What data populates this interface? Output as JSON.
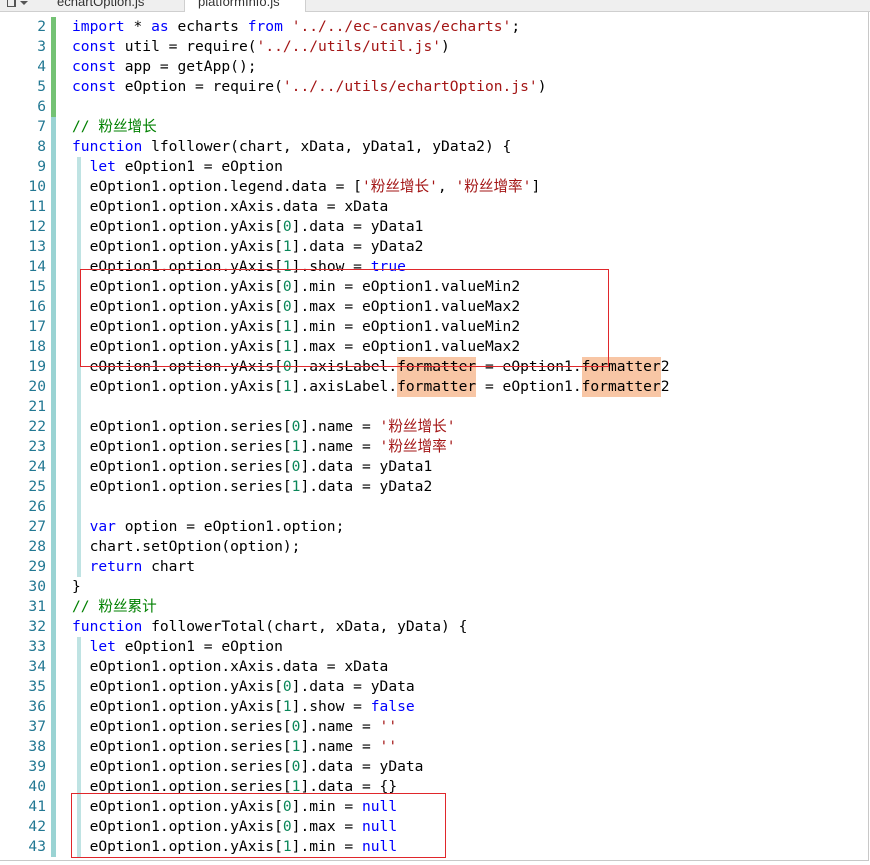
{
  "tabs": {
    "menu_icon": "tab-list-icon",
    "items": [
      {
        "label": "echartOption.js",
        "active": false
      },
      {
        "label": "platformInfo.js",
        "active": true
      }
    ]
  },
  "colors": {
    "keyword": "#0000ff",
    "string": "#a31515",
    "comment": "#008000",
    "number": "#098658",
    "text": "#000000",
    "line_number": "#237893",
    "search_highlight": "#f8c6a5",
    "annotation_box": "#e0272b",
    "change_bar_saved": "#74c274",
    "change_bar_modified": "#9ad3d3",
    "indent_guide": "#bfe3e3"
  },
  "lines": [
    {
      "n": "2",
      "tokens": [
        {
          "kw": "import"
        },
        {
          "txt": " * "
        },
        {
          "kw": "as"
        },
        {
          "txt": " echarts "
        },
        {
          "kw": "from"
        },
        {
          "txt": " "
        },
        {
          "str": "'../../ec-canvas/echarts'"
        },
        {
          "txt": ";"
        }
      ]
    },
    {
      "n": "3",
      "tokens": [
        {
          "kw": "const"
        },
        {
          "txt": " util = require("
        },
        {
          "str": "'../../utils/util.js'"
        },
        {
          "txt": ")"
        }
      ]
    },
    {
      "n": "4",
      "tokens": [
        {
          "kw": "const"
        },
        {
          "txt": " app = getApp();"
        }
      ]
    },
    {
      "n": "5",
      "tokens": [
        {
          "kw": "const"
        },
        {
          "txt": " eOption = require("
        },
        {
          "str": "'../../utils/echartOption.js'"
        },
        {
          "txt": ")"
        }
      ]
    },
    {
      "n": "6",
      "tokens": []
    },
    {
      "n": "7",
      "tokens": [
        {
          "cmt": "// 粉丝增长"
        }
      ]
    },
    {
      "n": "8",
      "tokens": [
        {
          "kw": "function"
        },
        {
          "txt": " lfollower(chart, xData, yData1, yData2) {"
        }
      ]
    },
    {
      "n": "9",
      "tokens": [
        {
          "txt": "  "
        },
        {
          "kw": "let"
        },
        {
          "txt": " eOption1 = eOption"
        }
      ]
    },
    {
      "n": "10",
      "tokens": [
        {
          "txt": "  eOption1.option.legend.data = ["
        },
        {
          "str": "'粉丝增长'"
        },
        {
          "txt": ", "
        },
        {
          "str": "'粉丝增率'"
        },
        {
          "txt": "]"
        }
      ]
    },
    {
      "n": "11",
      "tokens": [
        {
          "txt": "  eOption1.option.xAxis.data = xData"
        }
      ]
    },
    {
      "n": "12",
      "tokens": [
        {
          "txt": "  eOption1.option.yAxis["
        },
        {
          "num": "0"
        },
        {
          "txt": "].data = yData1"
        }
      ]
    },
    {
      "n": "13",
      "tokens": [
        {
          "txt": "  eOption1.option.yAxis["
        },
        {
          "num": "1"
        },
        {
          "txt": "].data = yData2"
        }
      ]
    },
    {
      "n": "14",
      "tokens": [
        {
          "txt": "  eOption1.option.yAxis["
        },
        {
          "num": "1"
        },
        {
          "txt": "].show = "
        },
        {
          "kw": "true"
        }
      ]
    },
    {
      "n": "15",
      "tokens": [
        {
          "txt": "  eOption1.option.yAxis["
        },
        {
          "num": "0"
        },
        {
          "txt": "].min = eOption1.valueMin2"
        }
      ]
    },
    {
      "n": "16",
      "tokens": [
        {
          "txt": "  eOption1.option.yAxis["
        },
        {
          "num": "0"
        },
        {
          "txt": "].max = eOption1.valueMax2"
        }
      ]
    },
    {
      "n": "17",
      "tokens": [
        {
          "txt": "  eOption1.option.yAxis["
        },
        {
          "num": "1"
        },
        {
          "txt": "].min = eOption1.valueMin2"
        }
      ]
    },
    {
      "n": "18",
      "tokens": [
        {
          "txt": "  eOption1.option.yAxis["
        },
        {
          "num": "1"
        },
        {
          "txt": "].max = eOption1.valueMax2"
        }
      ]
    },
    {
      "n": "19",
      "tokens": [
        {
          "txt": "  eOption1.option.yAxis["
        },
        {
          "num": "0"
        },
        {
          "txt": "].axisLabel."
        },
        {
          "hl": "formatter"
        },
        {
          "txt": " = eOption1."
        },
        {
          "hl": "formatter"
        },
        {
          "txt": "2"
        }
      ]
    },
    {
      "n": "20",
      "tokens": [
        {
          "txt": "  eOption1.option.yAxis["
        },
        {
          "num": "1"
        },
        {
          "txt": "].axisLabel."
        },
        {
          "hl": "formatter"
        },
        {
          "txt": " = eOption1."
        },
        {
          "hl": "formatter"
        },
        {
          "txt": "2"
        }
      ]
    },
    {
      "n": "21",
      "tokens": []
    },
    {
      "n": "22",
      "tokens": [
        {
          "txt": "  eOption1.option.series["
        },
        {
          "num": "0"
        },
        {
          "txt": "].name = "
        },
        {
          "str": "'粉丝增长'"
        }
      ]
    },
    {
      "n": "23",
      "tokens": [
        {
          "txt": "  eOption1.option.series["
        },
        {
          "num": "1"
        },
        {
          "txt": "].name = "
        },
        {
          "str": "'粉丝增率'"
        }
      ]
    },
    {
      "n": "24",
      "tokens": [
        {
          "txt": "  eOption1.option.series["
        },
        {
          "num": "0"
        },
        {
          "txt": "].data = yData1"
        }
      ]
    },
    {
      "n": "25",
      "tokens": [
        {
          "txt": "  eOption1.option.series["
        },
        {
          "num": "1"
        },
        {
          "txt": "].data = yData2"
        }
      ]
    },
    {
      "n": "26",
      "tokens": []
    },
    {
      "n": "27",
      "tokens": [
        {
          "txt": "  "
        },
        {
          "kw": "var"
        },
        {
          "txt": " option = eOption1.option;"
        }
      ]
    },
    {
      "n": "28",
      "tokens": [
        {
          "txt": "  chart.setOption(option);"
        }
      ]
    },
    {
      "n": "29",
      "tokens": [
        {
          "txt": "  "
        },
        {
          "kw": "return"
        },
        {
          "txt": " chart"
        }
      ]
    },
    {
      "n": "30",
      "tokens": [
        {
          "txt": "}"
        }
      ]
    },
    {
      "n": "31",
      "tokens": [
        {
          "cmt": "// 粉丝累计"
        }
      ]
    },
    {
      "n": "32",
      "tokens": [
        {
          "kw": "function"
        },
        {
          "txt": " followerTotal(chart, xData, yData) {"
        }
      ]
    },
    {
      "n": "33",
      "tokens": [
        {
          "txt": "  "
        },
        {
          "kw": "let"
        },
        {
          "txt": " eOption1 = eOption"
        }
      ]
    },
    {
      "n": "34",
      "tokens": [
        {
          "txt": "  eOption1.option.xAxis.data = xData"
        }
      ]
    },
    {
      "n": "35",
      "tokens": [
        {
          "txt": "  eOption1.option.yAxis["
        },
        {
          "num": "0"
        },
        {
          "txt": "].data = yData"
        }
      ]
    },
    {
      "n": "36",
      "tokens": [
        {
          "txt": "  eOption1.option.yAxis["
        },
        {
          "num": "1"
        },
        {
          "txt": "].show = "
        },
        {
          "kw": "false"
        }
      ]
    },
    {
      "n": "37",
      "tokens": [
        {
          "txt": "  eOption1.option.series["
        },
        {
          "num": "0"
        },
        {
          "txt": "].name = "
        },
        {
          "str": "''"
        }
      ]
    },
    {
      "n": "38",
      "tokens": [
        {
          "txt": "  eOption1.option.series["
        },
        {
          "num": "1"
        },
        {
          "txt": "].name = "
        },
        {
          "str": "''"
        }
      ]
    },
    {
      "n": "39",
      "tokens": [
        {
          "txt": "  eOption1.option.series["
        },
        {
          "num": "0"
        },
        {
          "txt": "].data = yData"
        }
      ]
    },
    {
      "n": "40",
      "tokens": [
        {
          "txt": "  eOption1.option.series["
        },
        {
          "num": "1"
        },
        {
          "txt": "].data = {}"
        }
      ]
    },
    {
      "n": "41",
      "tokens": [
        {
          "txt": "  eOption1.option.yAxis["
        },
        {
          "num": "0"
        },
        {
          "txt": "].min = "
        },
        {
          "kw": "null"
        }
      ]
    },
    {
      "n": "42",
      "tokens": [
        {
          "txt": "  eOption1.option.yAxis["
        },
        {
          "num": "0"
        },
        {
          "txt": "].max = "
        },
        {
          "kw": "null"
        }
      ]
    },
    {
      "n": "43",
      "tokens": [
        {
          "txt": "  eOption1.option.yAxis["
        },
        {
          "num": "1"
        },
        {
          "txt": "].min = "
        },
        {
          "kw": "null"
        }
      ]
    }
  ]
}
